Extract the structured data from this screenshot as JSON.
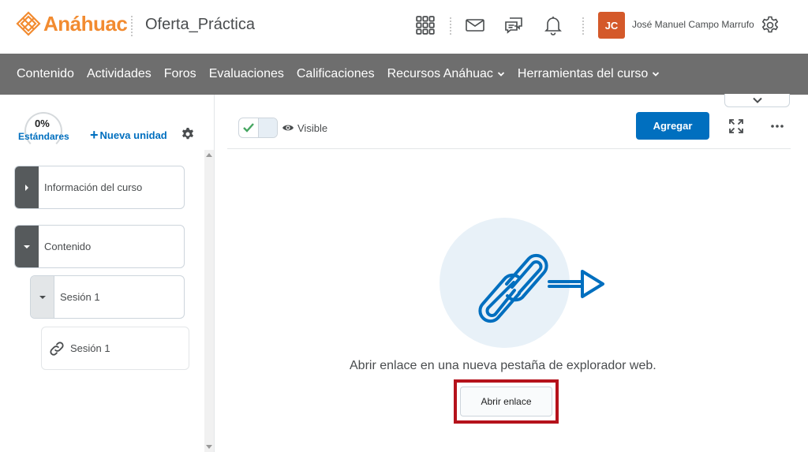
{
  "header": {
    "logo_text": "Anáhuac",
    "course_title": "Oferta_Práctica",
    "user_initials": "JC",
    "user_name": "José Manuel Campo Marrufo"
  },
  "navbar": {
    "items": [
      {
        "label": "Contenido",
        "dropdown": false
      },
      {
        "label": "Actividades",
        "dropdown": false
      },
      {
        "label": "Foros",
        "dropdown": false
      },
      {
        "label": "Evaluaciones",
        "dropdown": false
      },
      {
        "label": "Calificaciones",
        "dropdown": false
      },
      {
        "label": "Recursos Anáhuac",
        "dropdown": true
      },
      {
        "label": "Herramientas del curso",
        "dropdown": true
      }
    ]
  },
  "left_panel": {
    "progress": "0%",
    "standards_label": "Estándares",
    "new_unit_label": "Nueva unidad",
    "tree": {
      "course_info": "Información del curso",
      "content": "Contenido",
      "session_module": "Sesión 1",
      "session_link": "Sesión 1"
    }
  },
  "main": {
    "visibility_label": "Visible",
    "add_label": "Agregar",
    "open_message": "Abrir enlace en una nueva pestaña de explorador web.",
    "open_button": "Abrir enlace"
  },
  "colors": {
    "brand_orange": "#f28b30",
    "primary_blue": "#006fbf",
    "nav_gray": "#6e6e6e",
    "highlight_red": "#b5121b",
    "avatar": "#d4592a"
  }
}
